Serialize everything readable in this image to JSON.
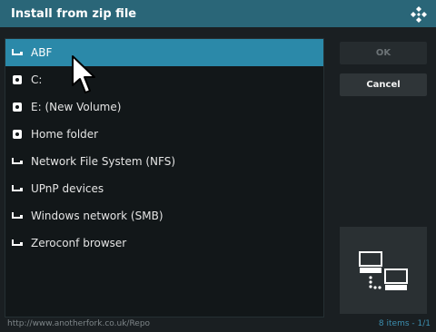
{
  "dialog": {
    "title": "Install from zip file"
  },
  "sources": [
    {
      "label": "ABF",
      "icon": "network-share-icon",
      "selected": true
    },
    {
      "label": "C:",
      "icon": "hard-drive-icon",
      "selected": false
    },
    {
      "label": "E: (New Volume)",
      "icon": "hard-drive-icon",
      "selected": false
    },
    {
      "label": "Home folder",
      "icon": "hard-drive-icon",
      "selected": false
    },
    {
      "label": "Network File System (NFS)",
      "icon": "network-share-icon",
      "selected": false
    },
    {
      "label": "UPnP devices",
      "icon": "network-share-icon",
      "selected": false
    },
    {
      "label": "Windows network (SMB)",
      "icon": "network-share-icon",
      "selected": false
    },
    {
      "label": "Zeroconf browser",
      "icon": "network-share-icon",
      "selected": false
    }
  ],
  "buttons": {
    "ok": "OK",
    "cancel": "Cancel"
  },
  "preview": {
    "icon": "network-computers-icon"
  },
  "footer": {
    "path": "http://www.anotherfork.co.uk/Repo",
    "count": "8 items - 1/1"
  },
  "colors": {
    "titlebar": "#2a6678",
    "selection": "#2b89a9",
    "background": "#1a1f22"
  }
}
